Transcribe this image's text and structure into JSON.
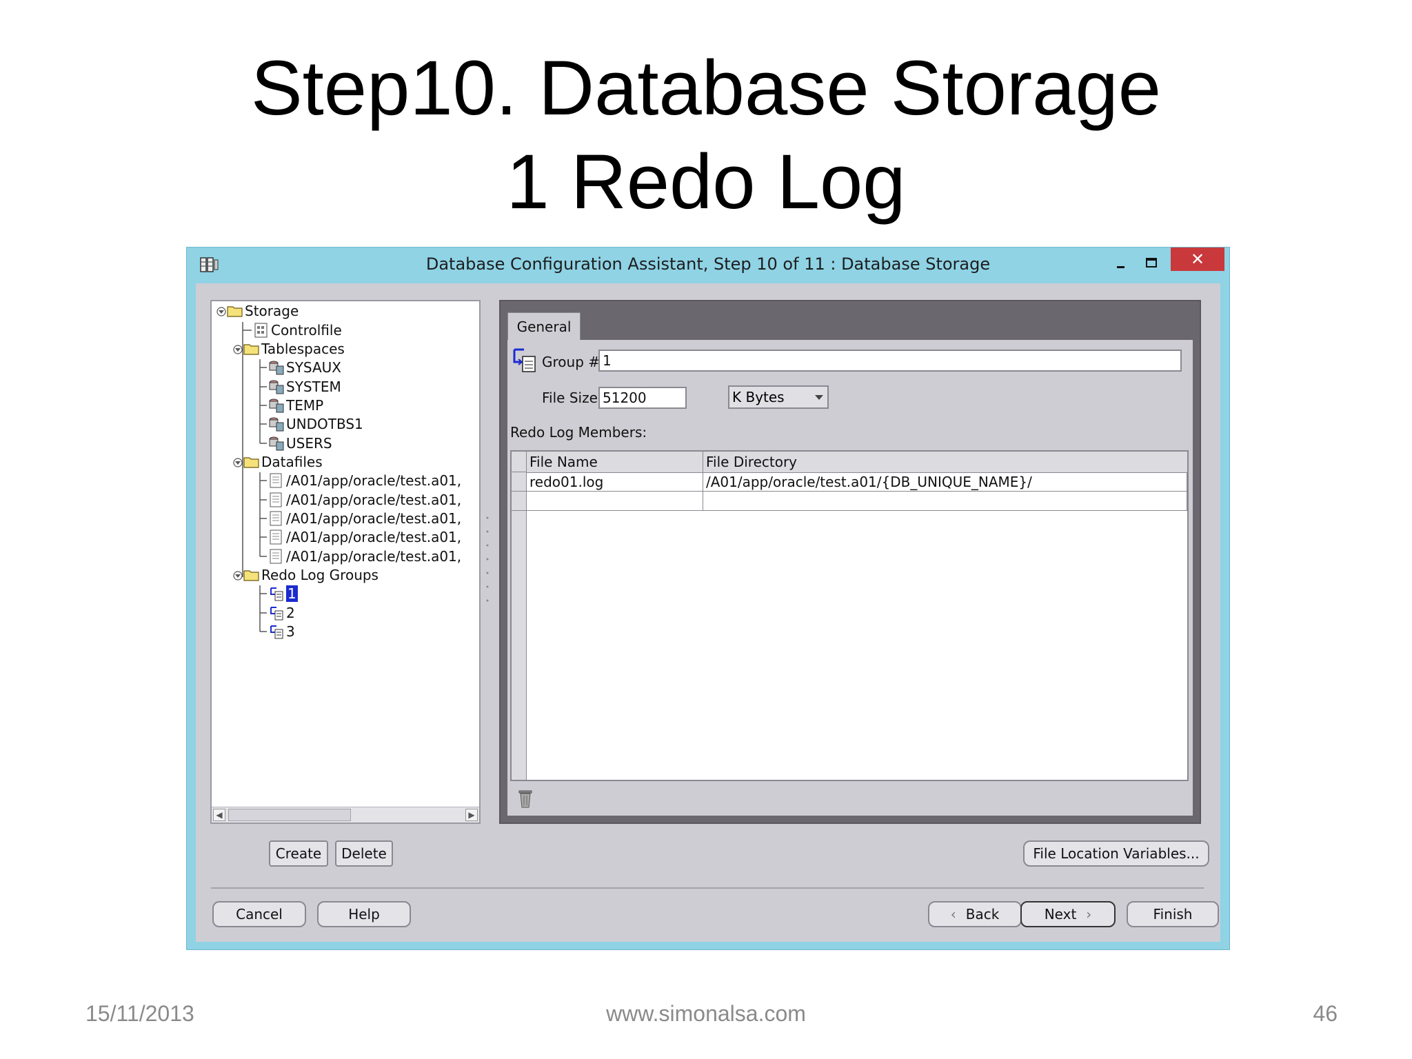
{
  "slide": {
    "title_line1": "Step10. Database Storage",
    "title_line2": "1 Redo Log",
    "footer_date": "15/11/2013",
    "footer_url": "www.simonalsa.com",
    "footer_page": "46"
  },
  "window": {
    "title": "Database Configuration Assistant, Step 10 of 11 : Database Storage",
    "close_glyph": "✕",
    "accent_color": "#8fd3e5",
    "close_color": "#c9393b"
  },
  "tree": {
    "items": [
      {
        "label": "Storage",
        "icon": "folder-icon"
      },
      {
        "label": "Controlfile",
        "icon": "controlfile-icon"
      },
      {
        "label": "Tablespaces",
        "icon": "folder-icon"
      },
      {
        "label": "SYSAUX",
        "icon": "tablespace-icon"
      },
      {
        "label": "SYSTEM",
        "icon": "tablespace-icon"
      },
      {
        "label": "TEMP",
        "icon": "tablespace-icon"
      },
      {
        "label": "UNDOTBS1",
        "icon": "tablespace-icon"
      },
      {
        "label": "USERS",
        "icon": "tablespace-icon"
      },
      {
        "label": "Datafiles",
        "icon": "folder-icon"
      },
      {
        "label": "/A01/app/oracle/test.a01,",
        "icon": "datafile-icon"
      },
      {
        "label": "/A01/app/oracle/test.a01,",
        "icon": "datafile-icon"
      },
      {
        "label": "/A01/app/oracle/test.a01,",
        "icon": "datafile-icon"
      },
      {
        "label": "/A01/app/oracle/test.a01,",
        "icon": "datafile-icon"
      },
      {
        "label": "/A01/app/oracle/test.a01,",
        "icon": "datafile-icon"
      },
      {
        "label": "Redo Log Groups",
        "icon": "folder-icon"
      },
      {
        "label": "1",
        "icon": "redo-log-group-icon",
        "selected": true
      },
      {
        "label": "2",
        "icon": "redo-log-group-icon"
      },
      {
        "label": "3",
        "icon": "redo-log-group-icon"
      }
    ],
    "create_label": "Create",
    "delete_label": "Delete"
  },
  "general": {
    "tab_label": "General",
    "group_label": "Group #:",
    "group_value": "1",
    "file_size_label": "File Size:",
    "file_size_value": "51200",
    "unit_value": "K Bytes",
    "members_label": "Redo Log Members:",
    "columns": [
      "File Name",
      "File Directory"
    ],
    "rows": [
      [
        "redo01.log",
        "/A01/app/oracle/test.a01/{DB_UNIQUE_NAME}/"
      ],
      [
        "",
        ""
      ]
    ],
    "file_location_label": "File Location Variables..."
  },
  "nav": {
    "cancel_label": "Cancel",
    "help_label": "Help",
    "back_label": "Back",
    "next_label": "Next",
    "finish_label": "Finish"
  }
}
